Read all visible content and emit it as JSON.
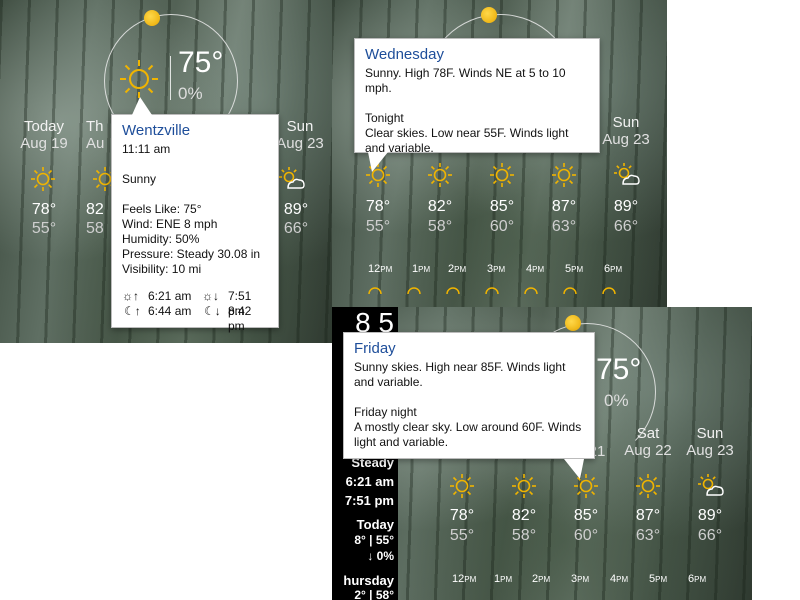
{
  "panel1": {
    "current_temp": "75°",
    "precip": "0%",
    "days": [
      {
        "day": "Today",
        "date": "Aug 19",
        "hi": "78°",
        "lo": "55°"
      },
      {
        "day": "Th",
        "date": "Au",
        "hi": "82",
        "lo": "58"
      },
      {
        "day": "Sun",
        "date": "Aug 23",
        "hi": "89°",
        "lo": "66°"
      }
    ],
    "tooltip": {
      "title": "Wentzville",
      "time": "11:11 am",
      "condition": "Sunny",
      "feels_like": "Feels Like: 75°",
      "wind": "Wind: ENE 8 mph",
      "humidity": "Humidity: 50%",
      "pressure": "Pressure: Steady 30.08 in",
      "visibility": "Visibility: 10 mi",
      "sunrise": "6:21 am",
      "sunset": "7:51 pm",
      "moonrise": "6:44 am",
      "moonset": "8:42 pm"
    }
  },
  "panel2": {
    "days": [
      {
        "hi": "78°",
        "lo": "55°"
      },
      {
        "hi": "82°",
        "lo": "58°"
      },
      {
        "hi": "85°",
        "lo": "60°"
      },
      {
        "hi": "87°",
        "lo": "63°"
      },
      {
        "hi": "89°",
        "lo": "66°"
      }
    ],
    "sun_label": {
      "day": "Sun",
      "date": "Aug 23"
    },
    "hours": [
      {
        "n": "12",
        "s": "PM"
      },
      {
        "n": "1",
        "s": "PM"
      },
      {
        "n": "2",
        "s": "PM"
      },
      {
        "n": "3",
        "s": "PM"
      },
      {
        "n": "4",
        "s": "PM"
      },
      {
        "n": "5",
        "s": "PM"
      },
      {
        "n": "6",
        "s": "PM"
      }
    ],
    "tooltip": {
      "title": "Wednesday",
      "line1": "Sunny. High 78F. Winds NE at 5 to 10 mph.",
      "sub": "Tonight",
      "line2": "Clear skies. Low near 55F. Winds light and variable."
    }
  },
  "panel3": {
    "current_temp": "75°",
    "precip": "0%",
    "left_strip": {
      "big": "8 5",
      "s1": "8",
      "s2": "Steady",
      "s3": "6:21 am",
      "s4": "7:51 pm",
      "s5": "Today",
      "s6": "8° | 55°",
      "s7": "↓     0%",
      "s8": "hursday",
      "s9": "2° | 58°"
    },
    "days": [
      {
        "day": "",
        "date": "21",
        "hi": "78°",
        "lo": "55°"
      },
      {
        "day": "",
        "date": "",
        "hi": "82°",
        "lo": "58°"
      },
      {
        "day": "",
        "date": "",
        "hi": "85°",
        "lo": "60°"
      },
      {
        "day": "Sat",
        "date": "Aug 22",
        "hi": "87°",
        "lo": "63°"
      },
      {
        "day": "Sun",
        "date": "Aug 23",
        "hi": "89°",
        "lo": "66°"
      }
    ],
    "hours": [
      {
        "n": "12",
        "s": "PM"
      },
      {
        "n": "1",
        "s": "PM"
      },
      {
        "n": "2",
        "s": "PM"
      },
      {
        "n": "3",
        "s": "PM"
      },
      {
        "n": "4",
        "s": "PM"
      },
      {
        "n": "5",
        "s": "PM"
      },
      {
        "n": "6",
        "s": "PM"
      }
    ],
    "tooltip": {
      "title": "Friday",
      "line1": "Sunny skies. High near 85F. Winds light and variable.",
      "sub": "Friday night",
      "line2": "A mostly clear sky. Low around 60F. Winds light and variable."
    }
  },
  "icons": {
    "sun": "sun-icon",
    "partly_cloudy": "partly-cloudy-icon",
    "sunrise": "sunrise-icon",
    "sunset": "sunset-icon",
    "moonrise": "moonrise-icon",
    "moonset": "moonset-icon"
  },
  "colors": {
    "sun": "#f0b400",
    "tooltip_title": "#1e4e9a"
  }
}
